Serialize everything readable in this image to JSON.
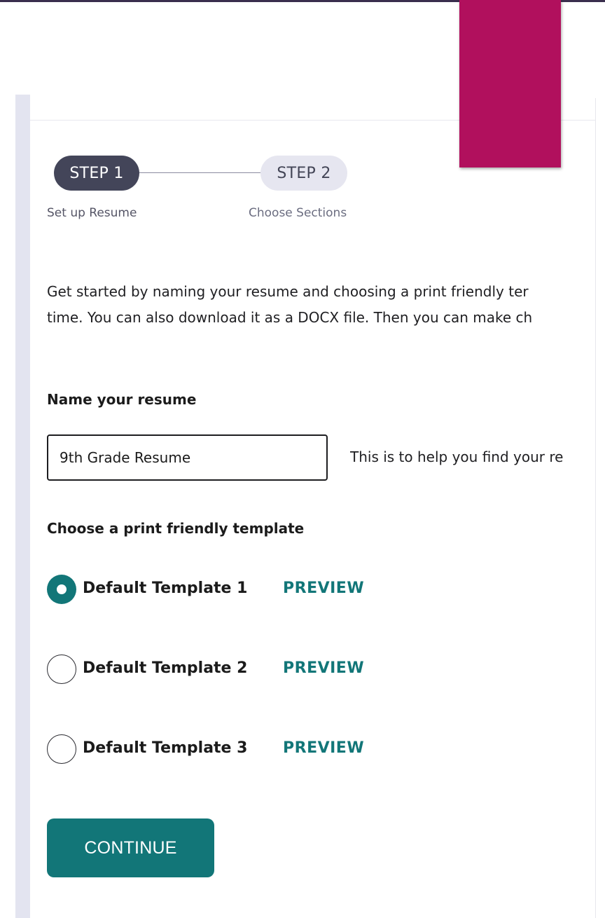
{
  "stepper": {
    "steps": [
      {
        "label": "STEP 1",
        "caption": "Set up Resume",
        "active": true
      },
      {
        "label": "STEP 2",
        "caption": "Choose Sections",
        "active": false
      }
    ]
  },
  "intro": {
    "line1": "Get started by naming your resume and choosing a print friendly ter",
    "line2": "time. You can also download it as a DOCX file. Then you can make ch"
  },
  "name_field": {
    "label": "Name your resume",
    "value": "9th Grade Resume",
    "help": "This is to help you find your re"
  },
  "templates": {
    "label": "Choose a print friendly template",
    "options": [
      {
        "name": "Default Template 1",
        "preview": "PREVIEW",
        "selected": true
      },
      {
        "name": "Default Template 2",
        "preview": "PREVIEW",
        "selected": false
      },
      {
        "name": "Default Template 3",
        "preview": "PREVIEW",
        "selected": false
      }
    ]
  },
  "actions": {
    "continue_label": "CONTINUE"
  },
  "colors": {
    "accent": "#127678",
    "bookmark": "#b1105d",
    "step_active": "#434559",
    "step_inactive": "#e6e6f0"
  }
}
